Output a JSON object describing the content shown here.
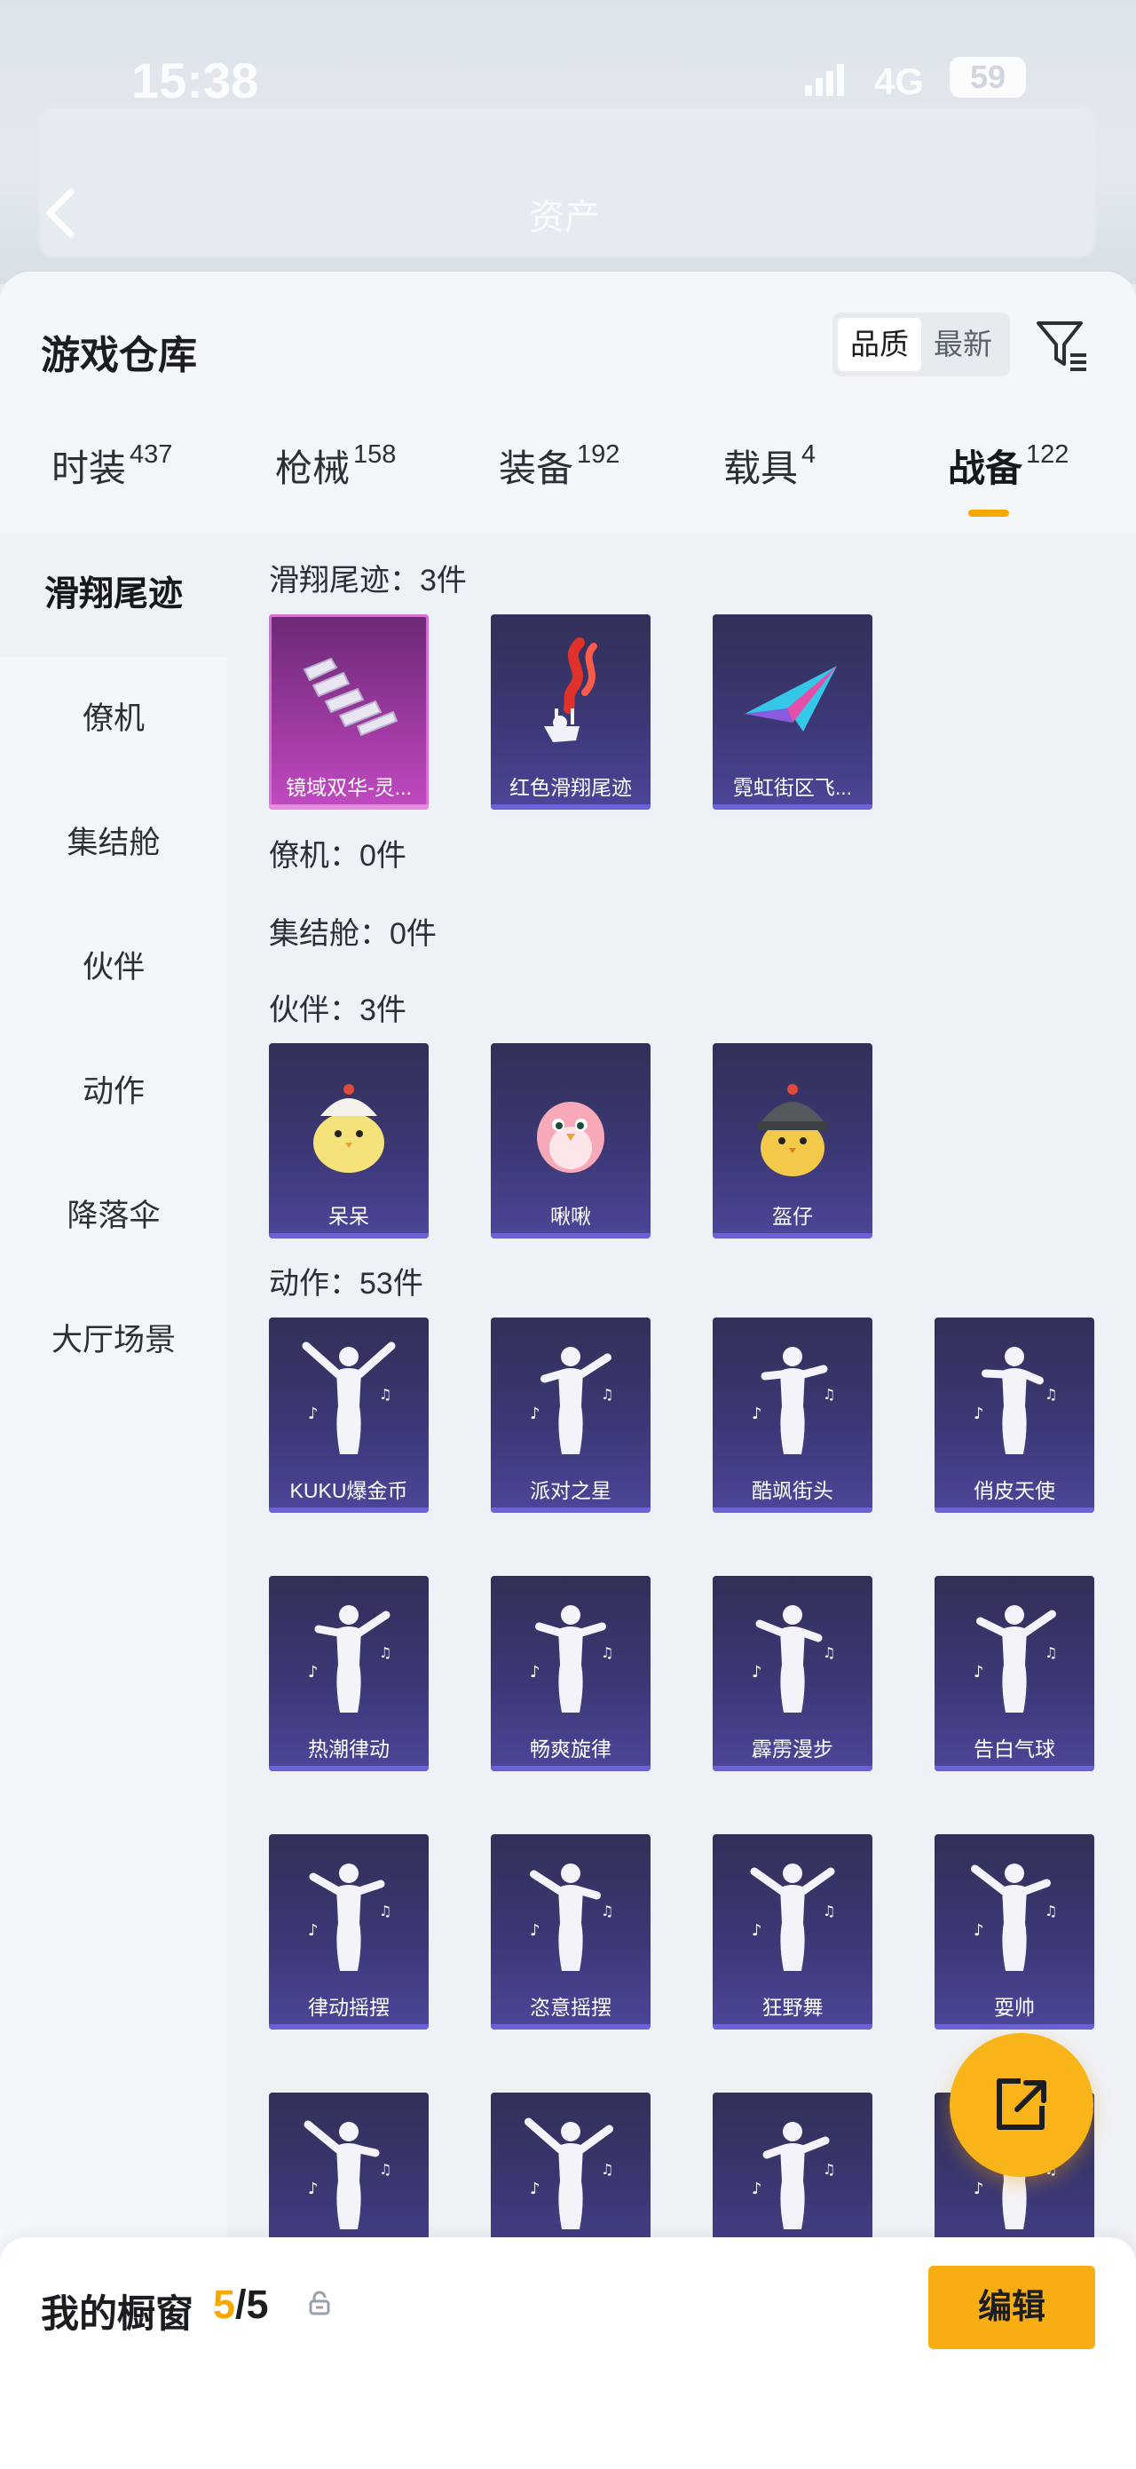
{
  "status_bar": {
    "time": "15:38",
    "network": "4G",
    "battery": "59"
  },
  "background": {
    "title": "资产"
  },
  "header": {
    "title": "游戏仓库",
    "sort_options": [
      "品质",
      "最新"
    ],
    "active_sort": "品质"
  },
  "tabs": [
    {
      "label": "时装",
      "count": "437"
    },
    {
      "label": "枪械",
      "count": "158"
    },
    {
      "label": "装备",
      "count": "192"
    },
    {
      "label": "载具",
      "count": "4"
    },
    {
      "label": "战备",
      "count": "122"
    }
  ],
  "categories": [
    "滑翔尾迹",
    "僚机",
    "集结舱",
    "伙伴",
    "动作",
    "降落伞",
    "大厅场景"
  ],
  "sections": [
    {
      "title": "滑翔尾迹：3件",
      "items": [
        "镜域双华-灵...",
        "红色滑翔尾迹",
        "霓虹街区飞..."
      ]
    },
    {
      "title": "僚机：0件",
      "items": []
    },
    {
      "title": "集结舱：0件",
      "items": []
    },
    {
      "title": "伙伴：3件",
      "items": [
        "呆呆",
        "啾啾",
        "盔仔"
      ]
    },
    {
      "title": "动作：53件",
      "items": [
        "KUKU爆金币",
        "派对之星",
        "酷飒街头",
        "俏皮天使",
        "热潮律动",
        "畅爽旋律",
        "霹雳漫步",
        "告白气球",
        "律动摇摆",
        "恣意摇摆",
        "狂野舞",
        "耍帅",
        "",
        "",
        "",
        ""
      ]
    }
  ],
  "bottom_bar": {
    "title": "我的橱窗",
    "count_current": "5",
    "count_total": "/5",
    "edit_label": "编辑"
  },
  "colors": {
    "accent": "#f7a800",
    "card_purple": "#3c3876",
    "card_pink": "#a03aa3"
  },
  "icons": [
    "back-icon",
    "filter-icon",
    "lock-icon",
    "share-icon"
  ]
}
